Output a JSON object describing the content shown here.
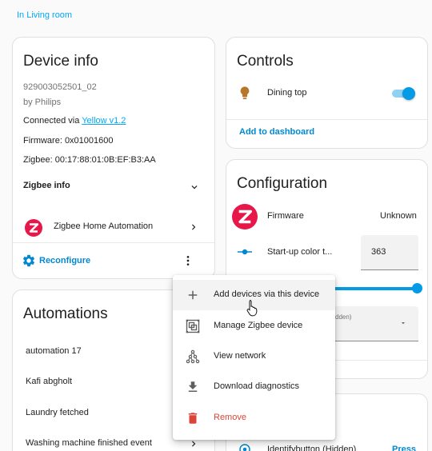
{
  "breadcrumb": {
    "area_link": "In Living room"
  },
  "device_info": {
    "title": "Device info",
    "model": "929003052501_02",
    "manufacturer": "by Philips",
    "connected_prefix": "Connected via ",
    "connected_link": "Yellow v1.2",
    "firmware": "Firmware: 0x01001600",
    "zigbee": "Zigbee: 00:17:88:01:0B:EF:B3:AA",
    "zigbee_info_label": "Zigbee info",
    "integration_label": "Zigbee Home Automation",
    "reconfigure_label": "Reconfigure"
  },
  "controls": {
    "title": "Controls",
    "entity_label": "Dining top",
    "toggle_on": true,
    "add_to_dashboard": "Add to dashboard"
  },
  "configuration": {
    "title": "Configuration",
    "firmware_label": "Firmware",
    "firmware_value": "Unknown",
    "startup_color_label": "Start-up color t...",
    "startup_color_value": "363",
    "hidden_select_fragment": "dden)"
  },
  "automations": {
    "title": "Automations",
    "items": [
      "automation 17",
      "Kafi abgholt",
      "Laundry fetched",
      "Washing machine finished event"
    ]
  },
  "diagnostic_card": {
    "identify_label": "Identifybutton (Hidden)",
    "press_label": "Press"
  },
  "context_menu": {
    "items": [
      {
        "label": "Add devices via this device",
        "icon": "plus-icon"
      },
      {
        "label": "Manage Zigbee device",
        "icon": "manage-zigbee-icon"
      },
      {
        "label": "View network",
        "icon": "network-icon"
      },
      {
        "label": "Download diagnostics",
        "icon": "download-icon"
      },
      {
        "label": "Remove",
        "icon": "delete-icon"
      }
    ]
  },
  "colors": {
    "accent": "#03a9f4",
    "link_dark": "#0288d1",
    "remove_red": "#db4437",
    "zigbee_red": "#e8174a",
    "bulb_orange": "#b8762b"
  }
}
